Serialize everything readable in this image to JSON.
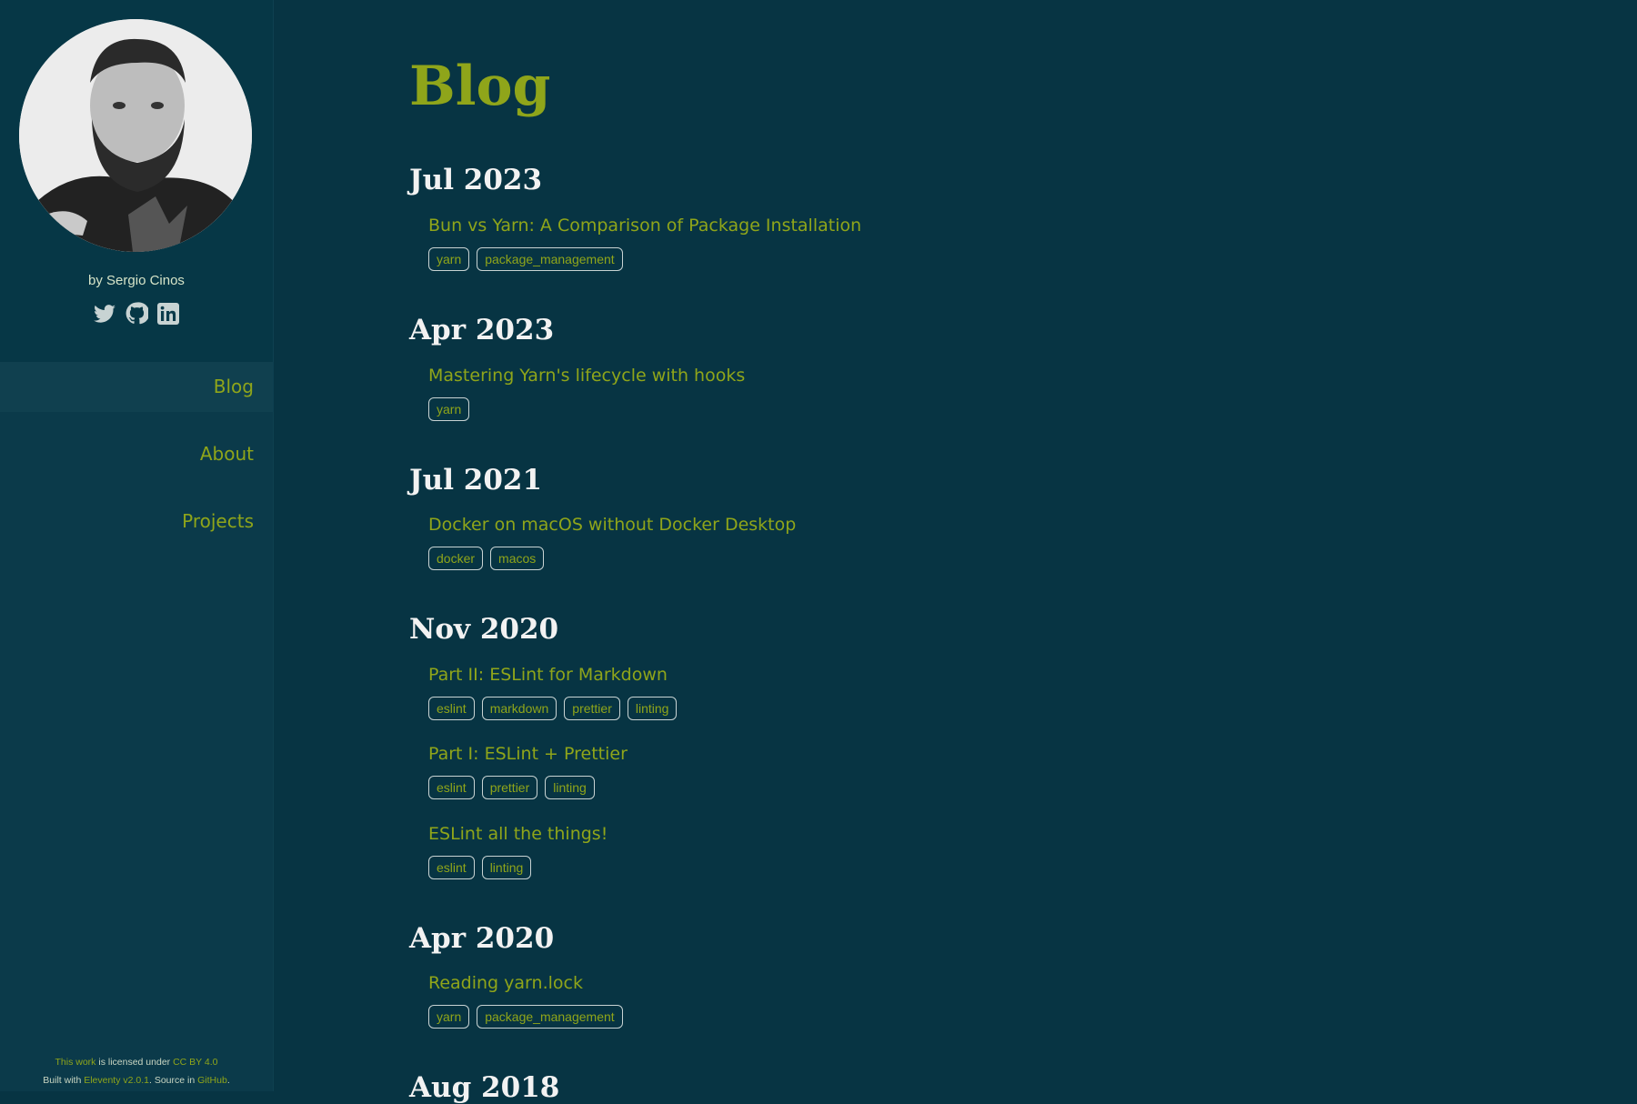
{
  "sidebar": {
    "byline": "by Sergio Cinos",
    "social": [
      "twitter-icon",
      "github-icon",
      "linkedin-icon"
    ],
    "nav": [
      {
        "label": "Blog",
        "active": true
      },
      {
        "label": "About",
        "active": false
      },
      {
        "label": "Projects",
        "active": false
      }
    ],
    "footer": {
      "line1_link1": "This work",
      "line1_mid": " is licensed under ",
      "line1_link2": "CC BY 4.0",
      "line2_prefix": "Built with ",
      "line2_link1": "Eleventy v2.0.1",
      "line2_mid": ". Source in ",
      "line2_link2": "GitHub",
      "line2_suffix": "."
    }
  },
  "main": {
    "title": "Blog",
    "groups": [
      {
        "month": "Jul 2023",
        "posts": [
          {
            "title": "Bun vs Yarn: A Comparison of Package Installation",
            "tags": [
              "yarn",
              "package_management"
            ]
          }
        ]
      },
      {
        "month": "Apr 2023",
        "posts": [
          {
            "title": "Mastering Yarn's lifecycle with hooks",
            "tags": [
              "yarn"
            ]
          }
        ]
      },
      {
        "month": "Jul 2021",
        "posts": [
          {
            "title": "Docker on macOS without Docker Desktop",
            "tags": [
              "docker",
              "macos"
            ]
          }
        ]
      },
      {
        "month": "Nov 2020",
        "posts": [
          {
            "title": "Part II: ESLint for Markdown",
            "tags": [
              "eslint",
              "markdown",
              "prettier",
              "linting"
            ]
          },
          {
            "title": "Part I: ESLint + Prettier",
            "tags": [
              "eslint",
              "prettier",
              "linting"
            ]
          },
          {
            "title": "ESLint all the things!",
            "tags": [
              "eslint",
              "linting"
            ]
          }
        ]
      },
      {
        "month": "Apr 2020",
        "posts": [
          {
            "title": "Reading yarn.lock",
            "tags": [
              "yarn",
              "package_management"
            ]
          }
        ]
      },
      {
        "month": "Aug 2018",
        "posts": []
      }
    ]
  },
  "colors": {
    "background": "#073443",
    "sidebar": "#0b3a4a",
    "accent": "#8fa51a",
    "heading": "#f2f2f2"
  }
}
